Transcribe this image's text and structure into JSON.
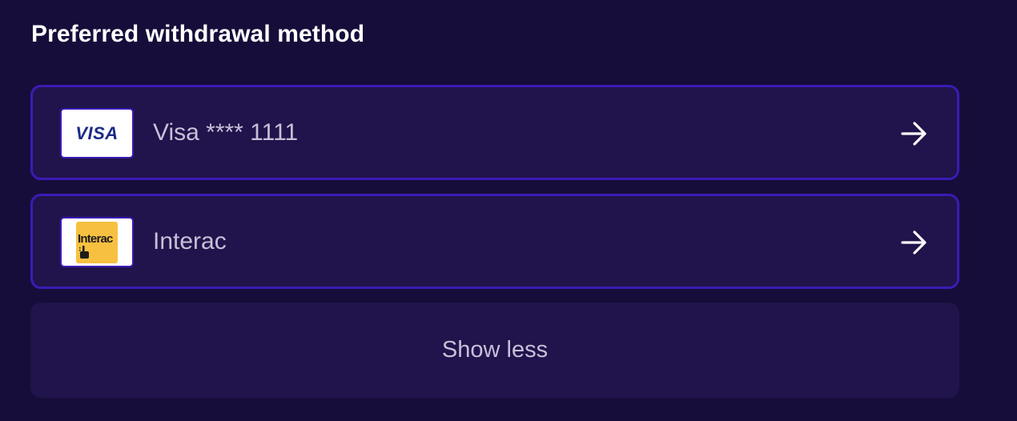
{
  "section": {
    "title": "Preferred withdrawal method"
  },
  "methods": [
    {
      "label": "Visa **** 1111",
      "logo_text": "VISA",
      "logo_icon": "visa-logo-icon",
      "action_icon": "arrow-right-icon"
    },
    {
      "label": "Interac",
      "logo_text": "Interac",
      "logo_icon": "interac-logo-icon",
      "action_icon": "arrow-right-icon"
    }
  ],
  "toggle": {
    "label": "Show less"
  },
  "colors": {
    "background": "#170d3a",
    "card": "#21134b",
    "border_accent": "#3a1bb5",
    "text_primary": "#ffffff",
    "text_secondary": "#c9bfd8",
    "visa_blue": "#1a2a86",
    "interac_yellow": "#f7c040"
  }
}
